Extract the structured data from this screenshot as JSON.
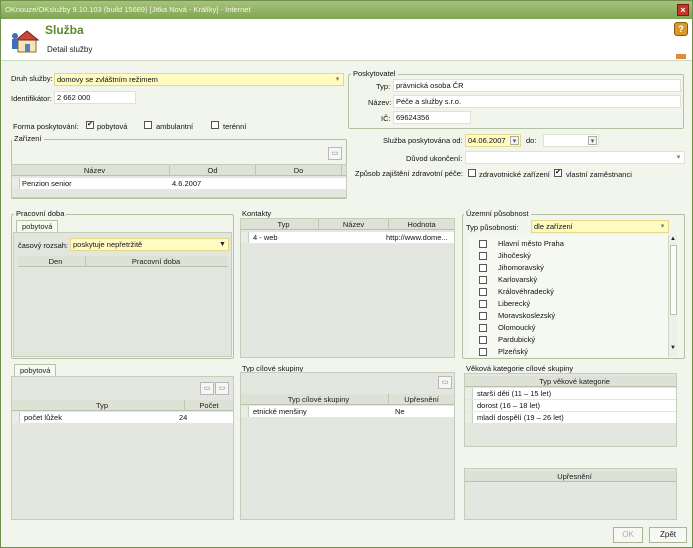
{
  "window": {
    "title": "OKnouze/OKslužby 9.10.103 (build 15669)  [Jitka Nová - Králíky] - Internet"
  },
  "header": {
    "title": "Služba",
    "subtitle": "Detail služby"
  },
  "form": {
    "druh_label": "Druh služby:",
    "druh_value": "domovy se zvláštním režimem",
    "identifikator_label": "Identifikátor:",
    "identifikator_value": "2 662 000",
    "forma_label": "Forma poskytování:",
    "forma_options": [
      {
        "label": "pobytová",
        "checked": true
      },
      {
        "label": "ambulantní",
        "checked": false
      },
      {
        "label": "terénní",
        "checked": false
      }
    ]
  },
  "poskytovatel": {
    "title": "Poskytovatel",
    "typ_label": "Typ:",
    "typ_value": "právnická osoba ČR",
    "nazev_label": "Název:",
    "nazev_value": "Péče a služby s.r.o.",
    "ic_label": "IČ:",
    "ic_value": "69624356"
  },
  "sluzba": {
    "od_label": "Služba poskytována od:",
    "od_value": "04.06.2007",
    "do_label": "do:",
    "do_value": "",
    "duvod_label": "Důvod ukončení:",
    "duvod_value": "",
    "zpusob_label": "Způsob zajištění zdravotní péče:",
    "zpusob_options": [
      {
        "label": "zdravotnické zařízení",
        "checked": false
      },
      {
        "label": "vlastní zaměstnanci",
        "checked": true
      }
    ]
  },
  "zarizeni": {
    "title": "Zařízení",
    "columns": [
      "Název",
      "Od",
      "Do"
    ],
    "rows": [
      [
        "Penzion senior",
        "4.6.2007",
        ""
      ]
    ]
  },
  "pracovni_doba": {
    "title": "Pracovní doba",
    "tab": "pobytová",
    "rozsah_label": "časový rozsah:",
    "rozsah_value": "poskytuje nepřetržitě",
    "columns": [
      "Den",
      "Pracovní doba"
    ]
  },
  "kontakty": {
    "title": "Kontakty",
    "columns": [
      "Typ",
      "Název",
      "Hodnota"
    ],
    "rows": [
      [
        "4 - web",
        "",
        "http://www.dome..."
      ]
    ]
  },
  "uzemni": {
    "title": "Územní působnost",
    "typ_label": "Typ působnosti:",
    "typ_value": "dle zařízení",
    "regions": [
      "Hlavní město Praha",
      "Jihočeský",
      "Jihomoravský",
      "Karlovarský",
      "Královéhradecký",
      "Liberecký",
      "Moravskoslezský",
      "Olomoucký",
      "Pardubický",
      "Plzeňský"
    ]
  },
  "kapacita": {
    "tab": "pobytová",
    "columns": [
      "Typ",
      "Počet"
    ],
    "rows": [
      [
        "počet lůžek",
        "24"
      ]
    ]
  },
  "cilove_skupiny": {
    "title": "Typ cílové skupiny",
    "columns": [
      "Typ cílové skupiny",
      "Upřesnění"
    ],
    "rows": [
      [
        "etnické menšiny",
        "Ne"
      ]
    ]
  },
  "vekove": {
    "title": "Věková kategorie cílové skupiny",
    "column": "Typ věkové kategorie",
    "rows": [
      "starší děti (11 – 15 let)",
      "dorost (16 – 18 let)",
      "mladí dospělí (19 – 26 let)"
    ],
    "upresneni_column": "Upřesnění"
  },
  "buttons": {
    "ok": "OK",
    "back": "Zpět"
  }
}
